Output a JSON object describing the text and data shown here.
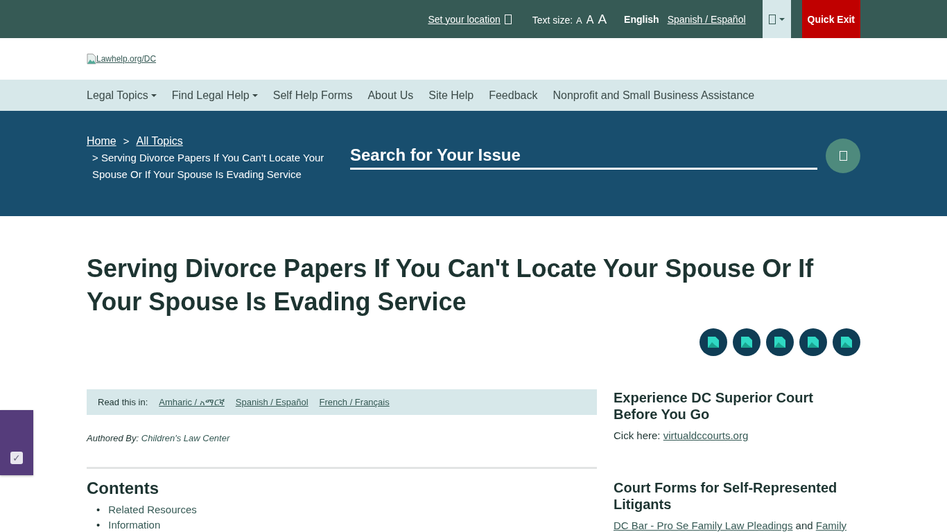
{
  "top_bar": {
    "location_link": "Set your location",
    "text_size_label": "Text size:",
    "text_sizes": [
      "A",
      "A",
      "A"
    ],
    "languages": [
      {
        "label": "English",
        "selected": true
      },
      {
        "label": "Spanish / Español",
        "selected": false
      }
    ],
    "quick_exit": "Quick Exit"
  },
  "logo": {
    "alt_text": "Lawhelp.org/DC"
  },
  "nav": [
    {
      "label": "Legal Topics",
      "has_menu": true
    },
    {
      "label": "Find Legal Help",
      "has_menu": true
    },
    {
      "label": "Self Help Forms",
      "has_menu": false
    },
    {
      "label": "About Us",
      "has_menu": false
    },
    {
      "label": "Site Help",
      "has_menu": false
    },
    {
      "label": "Feedback",
      "has_menu": false
    },
    {
      "label": "Nonprofit and Small Business Assistance",
      "has_menu": false
    }
  ],
  "breadcrumb": {
    "links": [
      "Home",
      "All Topics"
    ],
    "separator": ">",
    "current": "Serving Divorce Papers If You Can't Locate Your Spouse Or If Your Spouse Is Evading Service"
  },
  "search": {
    "placeholder": "Search for Your Issue"
  },
  "page_title": "Serving Divorce Papers If You Can't Locate Your Spouse Or If Your Spouse Is Evading Service",
  "read_in": {
    "label": "Read this in:",
    "links": [
      "Amharic / አማርኛ",
      "Spanish / Español",
      "French / Français"
    ]
  },
  "authored": {
    "label": "Authored By:",
    "link": "Children's Law Center"
  },
  "contents": {
    "title": "Contents",
    "marker": "•",
    "items": [
      "Related Resources",
      "Information"
    ]
  },
  "side_widget": {
    "checked": true,
    "checkbox_glyph": "✓"
  },
  "sidebar": [
    {
      "title": "Experience DC Superior Court Before You Go",
      "parts": [
        {
          "text": "Cick here: ",
          "link": false
        },
        {
          "text": "virtualdccourts.org",
          "link": true
        }
      ]
    },
    {
      "title": "Court Forms for Self-Represented Litigants",
      "parts": [
        {
          "text": "DC Bar - Pro Se Family Law Pleadings",
          "link": true
        },
        {
          "text": " and ",
          "link": false
        },
        {
          "text": "Family",
          "link": true
        }
      ]
    }
  ]
}
